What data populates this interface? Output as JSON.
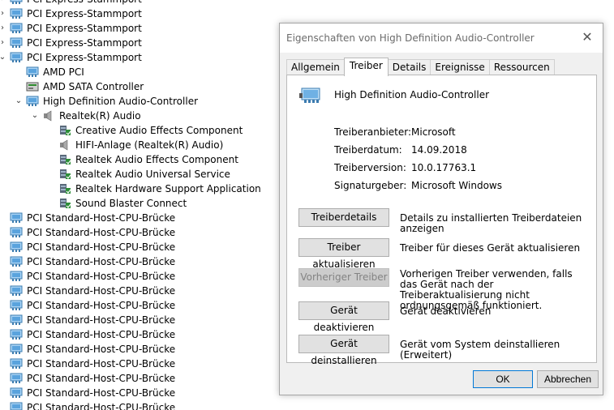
{
  "tree": {
    "items": [
      {
        "label": "PCI Express-Stammport",
        "level": 0,
        "icon": "pci-icon",
        "chevron": "collapsed"
      },
      {
        "label": "PCI Express-Stammport",
        "level": 0,
        "icon": "pci-icon",
        "chevron": "collapsed"
      },
      {
        "label": "PCI Express-Stammport",
        "level": 0,
        "icon": "pci-icon",
        "chevron": "collapsed"
      },
      {
        "label": "PCI Express-Stammport",
        "level": 0,
        "icon": "pci-icon",
        "chevron": "collapsed"
      },
      {
        "label": "PCI Express-Stammport",
        "level": 0,
        "icon": "pci-icon",
        "chevron": "expanded"
      },
      {
        "label": "AMD PCI",
        "level": 1,
        "icon": "pci-icon",
        "chevron": ""
      },
      {
        "label": "AMD SATA Controller",
        "level": 1,
        "icon": "sata-controller-icon",
        "chevron": ""
      },
      {
        "label": "High Definition Audio-Controller",
        "level": 1,
        "icon": "pci-icon",
        "chevron": "expanded"
      },
      {
        "label": "Realtek(R) Audio",
        "level": 2,
        "icon": "speaker-icon",
        "chevron": "expanded"
      },
      {
        "label": "Creative Audio Effects Component",
        "level": 3,
        "icon": "software-component-icon",
        "chevron": ""
      },
      {
        "label": "HIFI-Anlage (Realtek(R) Audio)",
        "level": 3,
        "icon": "speaker-icon",
        "chevron": ""
      },
      {
        "label": "Realtek Audio Effects Component",
        "level": 3,
        "icon": "software-component-icon",
        "chevron": ""
      },
      {
        "label": "Realtek Audio Universal Service",
        "level": 3,
        "icon": "software-component-icon",
        "chevron": ""
      },
      {
        "label": "Realtek Hardware Support Application",
        "level": 3,
        "icon": "software-component-icon",
        "chevron": ""
      },
      {
        "label": "Sound Blaster Connect",
        "level": 3,
        "icon": "software-component-icon",
        "chevron": ""
      },
      {
        "label": "PCI Standard-Host-CPU-Brücke",
        "level": 0,
        "icon": "pci-icon",
        "chevron": ""
      },
      {
        "label": "PCI Standard-Host-CPU-Brücke",
        "level": 0,
        "icon": "pci-icon",
        "chevron": ""
      },
      {
        "label": "PCI Standard-Host-CPU-Brücke",
        "level": 0,
        "icon": "pci-icon",
        "chevron": ""
      },
      {
        "label": "PCI Standard-Host-CPU-Brücke",
        "level": 0,
        "icon": "pci-icon",
        "chevron": ""
      },
      {
        "label": "PCI Standard-Host-CPU-Brücke",
        "level": 0,
        "icon": "pci-icon",
        "chevron": ""
      },
      {
        "label": "PCI Standard-Host-CPU-Brücke",
        "level": 0,
        "icon": "pci-icon",
        "chevron": ""
      },
      {
        "label": "PCI Standard-Host-CPU-Brücke",
        "level": 0,
        "icon": "pci-icon",
        "chevron": ""
      },
      {
        "label": "PCI Standard-Host-CPU-Brücke",
        "level": 0,
        "icon": "pci-icon",
        "chevron": ""
      },
      {
        "label": "PCI Standard-Host-CPU-Brücke",
        "level": 0,
        "icon": "pci-icon",
        "chevron": ""
      },
      {
        "label": "PCI Standard-Host-CPU-Brücke",
        "level": 0,
        "icon": "pci-icon",
        "chevron": ""
      },
      {
        "label": "PCI Standard-Host-CPU-Brücke",
        "level": 0,
        "icon": "pci-icon",
        "chevron": ""
      },
      {
        "label": "PCI Standard-Host-CPU-Brücke",
        "level": 0,
        "icon": "pci-icon",
        "chevron": ""
      },
      {
        "label": "PCI Standard-Host-CPU-Brücke",
        "level": 0,
        "icon": "pci-icon",
        "chevron": ""
      },
      {
        "label": "PCI Standard-Host-CPU-Brücke",
        "level": 0,
        "icon": "pci-icon",
        "chevron": ""
      }
    ]
  },
  "dialog": {
    "title": "Eigenschaften von High Definition Audio-Controller",
    "close_icon": "close-icon",
    "tabs": [
      {
        "label": "Allgemein",
        "active": false
      },
      {
        "label": "Treiber",
        "active": true
      },
      {
        "label": "Details",
        "active": false
      },
      {
        "label": "Ereignisse",
        "active": false
      },
      {
        "label": "Ressourcen",
        "active": false
      }
    ],
    "device_name": "High Definition Audio-Controller",
    "device_icon": "audio-controller-icon",
    "properties": [
      {
        "label": "Treiberanbieter:",
        "value": "Microsoft"
      },
      {
        "label": "Treiberdatum:",
        "value": "14.09.2018"
      },
      {
        "label": "Treiberversion:",
        "value": "10.0.17763.1"
      },
      {
        "label": "Signaturgeber:",
        "value": "Microsoft Windows"
      }
    ],
    "actions": [
      {
        "label": "Treiberdetails",
        "description": "Details zu installierten Treiberdateien anzeigen",
        "enabled": true
      },
      {
        "label": "Treiber aktualisieren",
        "description": "Treiber für dieses Gerät aktualisieren",
        "enabled": true
      },
      {
        "label": "Vorheriger Treiber",
        "description": "Vorherigen Treiber verwenden, falls das Gerät nach der Treiberaktualisierung nicht ordnungsgemäß funktioniert.",
        "enabled": false
      },
      {
        "label": "Gerät deaktivieren",
        "description": "Gerät deaktivieren",
        "enabled": true
      },
      {
        "label": "Gerät deinstallieren",
        "description": "Gerät vom System deinstallieren (Erweitert)",
        "enabled": true
      }
    ],
    "ok_label": "OK",
    "cancel_label": "Abbrechen"
  },
  "colors": {
    "accent": "#0078d7",
    "dialog_bg": "#f0f0f0",
    "button_bg": "#e1e1e1",
    "title_text": "#6b6b6b"
  }
}
